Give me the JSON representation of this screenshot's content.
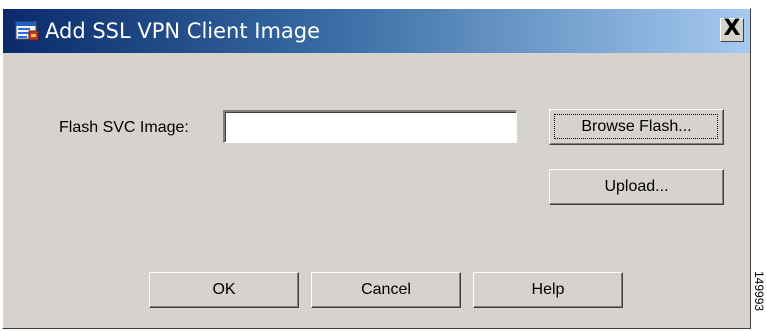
{
  "dialog": {
    "title": "Add SSL VPN Client Image",
    "close_label": "X"
  },
  "form": {
    "flash_label": "Flash SVC Image:",
    "flash_value": "",
    "browse_flash_label": "Browse Flash...",
    "upload_label": "Upload..."
  },
  "footer": {
    "ok_label": "OK",
    "cancel_label": "Cancel",
    "help_label": "Help"
  },
  "side_note": "149993",
  "colors": {
    "titlebar_start": "#0a2a6b",
    "titlebar_end": "#a6caf0",
    "dialog_bg": "#d6d3ce"
  }
}
